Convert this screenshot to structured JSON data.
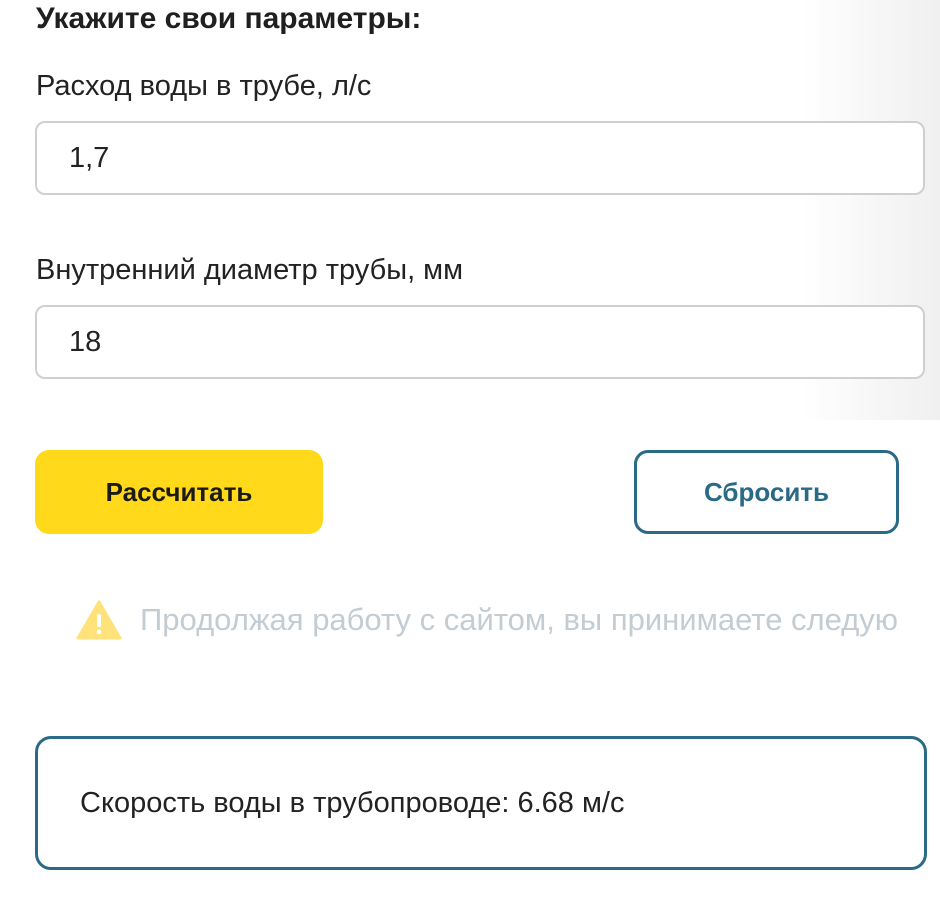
{
  "form": {
    "heading": "Укажите свои параметры:",
    "flow_label": "Расход воды в трубе, л/с",
    "flow_value": "1,7",
    "diameter_label": "Внутренний диаметр трубы, мм",
    "diameter_value": "18"
  },
  "buttons": {
    "calculate_label": "Рассчитать",
    "reset_label": "Сбросить"
  },
  "notice": {
    "icon": "warning-icon",
    "text": "Продолжая работу с сайтом, вы принимаете следую"
  },
  "result": {
    "text": "Скорость воды в трубопроводе: 6.68 м/с"
  },
  "colors": {
    "primary_button": "#ffd91a",
    "accent": "#2b6a86",
    "warning": "#ffe37a",
    "muted_text": "#c3ccd3"
  }
}
